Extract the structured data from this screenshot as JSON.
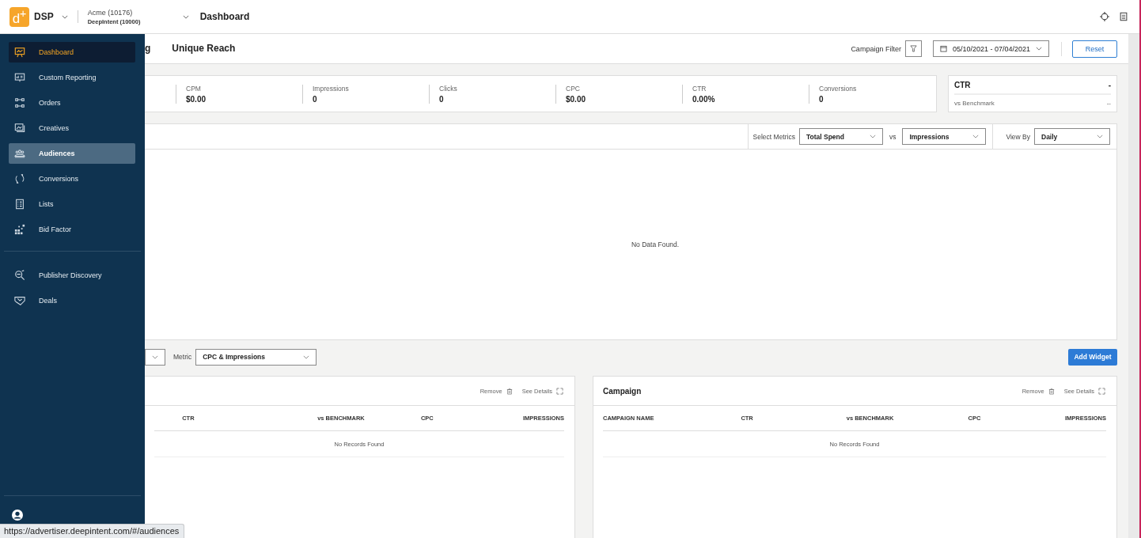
{
  "top_bar": {
    "logo_text": "d$^{+}$",
    "product": "DSP",
    "account": "Acme (10176)",
    "sub_account": "DeepIntent (10000)",
    "page_title": "Dashboard"
  },
  "sidebar": {
    "groups": [
      [
        {
          "label": "Dashboard",
          "selected": true,
          "hovered": false
        },
        {
          "label": "Custom Reporting",
          "selected": false,
          "hovered": false
        },
        {
          "label": "Orders",
          "selected": false,
          "hovered": false
        },
        {
          "label": "Creatives",
          "selected": false,
          "hovered": false
        },
        {
          "label": "Audiences",
          "selected": false,
          "hovered": true
        },
        {
          "label": "Conversions",
          "selected": false,
          "hovered": false
        },
        {
          "label": "Lists",
          "selected": false,
          "hovered": false
        },
        {
          "label": "Bid Factor",
          "selected": false,
          "hovered": false
        }
      ],
      [
        {
          "label": "Publisher Discovery",
          "selected": false,
          "hovered": false
        },
        {
          "label": "Deals",
          "selected": false,
          "hovered": false
        }
      ]
    ]
  },
  "tabs": [
    {
      "label": "g",
      "selected": false
    },
    {
      "label": "Unique Reach",
      "selected": false
    }
  ],
  "filters": {
    "campaign_filter_label": "Campaign Filter",
    "date_range": "05/10/2021 - 07/04/2021",
    "reset": "Reset"
  },
  "stats": [
    {
      "label": "CPM",
      "value": "$0.00"
    },
    {
      "label": "Impressions",
      "value": "0"
    },
    {
      "label": "Clicks",
      "value": "0"
    },
    {
      "label": "CPC",
      "value": "$0.00"
    },
    {
      "label": "CTR",
      "value": "0.00%"
    },
    {
      "label": "Conversions",
      "value": "0"
    }
  ],
  "ctr_card": {
    "title": "CTR",
    "value": "-",
    "benchmark_label": "vs Benchmark",
    "benchmark_value": "--"
  },
  "chart_panel": {
    "select_metrics_label": "Select Metrics",
    "metric_1": "Total Spend",
    "vs_label": "vs",
    "metric_2": "Impressions",
    "view_by_label": "View By",
    "view_by": "Daily",
    "empty_message": "No Data Found."
  },
  "widget_toolbar": {
    "metric_label": "Metric",
    "metric": "CPC & Impressions",
    "add_widget": "Add Widget"
  },
  "widgets": [
    {
      "remove": "Remove",
      "see_details": "See Details",
      "columns": [
        "CTR",
        "vs BENCHMARK",
        "CPC",
        "IMPRESSIONS"
      ],
      "empty_message": "No Records Found"
    },
    {
      "title": "Campaign",
      "remove": "Remove",
      "see_details": "See Details",
      "columns": [
        "CAMPAIGN NAME",
        "CTR",
        "vs BENCHMARK",
        "CPC",
        "IMPRESSIONS"
      ],
      "empty_message": "No Records Found"
    }
  ],
  "status_url": "https://advertiser.deepintent.com/#/audiences"
}
